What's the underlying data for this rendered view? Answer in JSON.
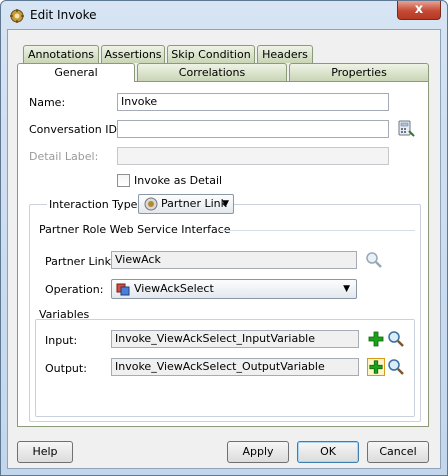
{
  "window": {
    "title": "Edit Invoke",
    "close_glyph": "x"
  },
  "tabs": {
    "row1": [
      "Annotations",
      "Assertions",
      "Skip Condition",
      "Headers"
    ],
    "row2": [
      "General",
      "Correlations",
      "Properties"
    ],
    "active": "General"
  },
  "general": {
    "name_label": "Name:",
    "name_value": "Invoke",
    "conversation_label": "Conversation ID:",
    "conversation_value": "",
    "detail_label": "Detail Label:",
    "detail_value": "",
    "invoke_detail_label": "Invoke as Detail",
    "invoke_detail_checked": false
  },
  "interaction": {
    "label": "Interaction Type:",
    "value": "Partner Link",
    "section_title": "Partner Role Web Service Interface",
    "partner_link_label": "Partner Link:",
    "partner_link_value": "ViewAck",
    "operation_label": "Operation:",
    "operation_value": "ViewAckSelect"
  },
  "variables": {
    "title": "Variables",
    "input_label": "Input:",
    "input_value": "Invoke_ViewAckSelect_InputVariable",
    "output_label": "Output:",
    "output_value": "Invoke_ViewAckSelect_OutputVariable"
  },
  "buttons": {
    "help": "Help",
    "apply": "Apply",
    "ok": "OK",
    "cancel": "Cancel"
  },
  "icons": {
    "app": "gear-app-icon",
    "browse": "calculator-browse-icon",
    "search": "magnifier-icon",
    "add": "green-plus-icon",
    "partner": "partner-link-icon",
    "operation": "operation-icon"
  },
  "colors": {
    "accent": "#3c7fb1",
    "close": "#c44a35",
    "plus": "#1aa31a"
  }
}
